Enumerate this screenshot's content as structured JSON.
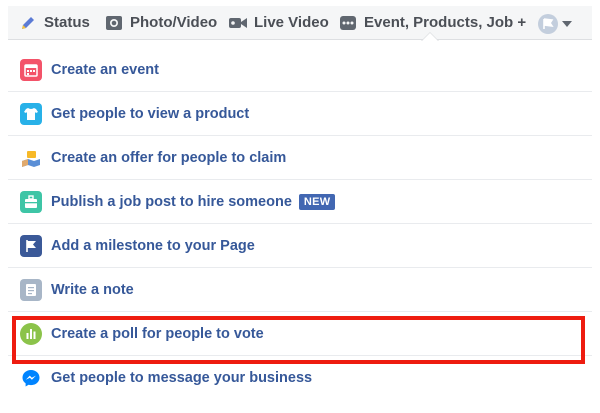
{
  "composer": {
    "tabs": [
      {
        "label": "Status",
        "icon": "pencil-icon"
      },
      {
        "label": "Photo/Video",
        "icon": "camera-icon"
      },
      {
        "label": "Live Video",
        "icon": "video-camera-icon"
      },
      {
        "label": "Event, Products, Job +",
        "icon": "more-dots-icon"
      }
    ],
    "profile_selector": {
      "icon": "page-avatar-icon"
    }
  },
  "menu": {
    "items": [
      {
        "label": "Create an event",
        "icon": "calendar-icon",
        "color": "#f35369"
      },
      {
        "label": "Get people to view a product",
        "icon": "shirt-icon",
        "color": "#28b1e8"
      },
      {
        "label": "Create an offer for people to claim",
        "icon": "offer-icon",
        "color": "#5b8fd6"
      },
      {
        "label": "Publish a job post to hire someone",
        "icon": "briefcase-icon",
        "color": "#3ec5a6",
        "badge": "NEW"
      },
      {
        "label": "Add a milestone to your Page",
        "icon": "flag-icon",
        "color": "#3b5998"
      },
      {
        "label": "Write a note",
        "icon": "note-icon",
        "color": "#a8b6c7"
      },
      {
        "label": "Create a poll for people to vote",
        "icon": "poll-icon",
        "color": "#8bc34a"
      },
      {
        "label": "Get people to message your business",
        "icon": "messenger-icon",
        "color": "#0084ff"
      }
    ]
  },
  "colors": {
    "link": "#365899",
    "highlight": "#ee1c10",
    "badge": "#4267b2"
  }
}
